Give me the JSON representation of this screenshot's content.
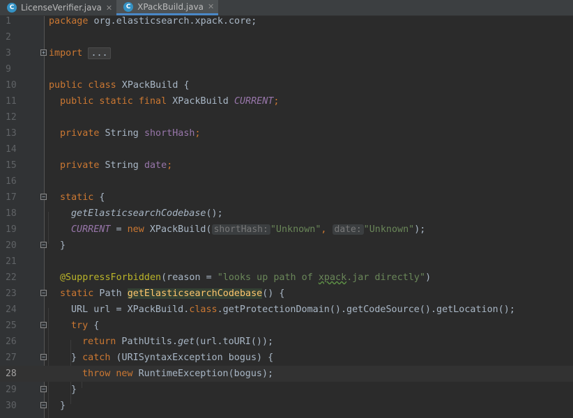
{
  "tabs": [
    {
      "label": "LicenseVerifier.java",
      "badge": "C",
      "active": false
    },
    {
      "label": "XPackBuild.java",
      "badge": "C",
      "active": true
    }
  ],
  "line_numbers": [
    "1",
    "2",
    "3",
    "9",
    "10",
    "11",
    "12",
    "13",
    "14",
    "15",
    "16",
    "17",
    "18",
    "19",
    "20",
    "21",
    "22",
    "23",
    "24",
    "25",
    "26",
    "27",
    "28",
    "29",
    "30"
  ],
  "current_line": "28",
  "code": {
    "l1": {
      "kw": "package",
      "rest": " org.elasticsearch.xpack.core;"
    },
    "l3": {
      "kw": "import",
      "pill": "..."
    },
    "l10": {
      "kw": "public class",
      "name": " XPackBuild",
      "rest": " {"
    },
    "l11": {
      "kw": "public static final",
      "type": " XPackBuild ",
      "field": "CURRENT",
      "end": ";"
    },
    "l13": {
      "kw": "private",
      "type": " String ",
      "field": "shortHash",
      "end": ";"
    },
    "l15": {
      "kw": "private",
      "type": " String ",
      "field": "date",
      "end": ";"
    },
    "l17": {
      "kw": "static",
      "rest": " {"
    },
    "l18": {
      "call": "getElasticsearchCodebase",
      "rest": "();"
    },
    "l19": {
      "field": "CURRENT",
      "eq": " = ",
      "kw": "new",
      "ctor": " XPackBuild(",
      "hint1": "shortHash:",
      "str1": "\"Unknown\"",
      "comma": ", ",
      "hint2": "date:",
      "str2": "\"Unknown\"",
      "end": ");"
    },
    "l20": {
      "rest": "}"
    },
    "l22": {
      "anno": "@SuppressForbidden",
      "open": "(reason = ",
      "str_a": "\"looks up path of ",
      "str_b": "xpack",
      "str_c": ".jar directly\"",
      "close": ")"
    },
    "l23": {
      "kw": "static",
      "type": " Path ",
      "method": "getElasticsearchCodebase",
      "rest": "() {"
    },
    "l24": {
      "a": "URL url = XPackBuild.",
      "kw": "class",
      "b": ".getProtectionDomain().getCodeSource().getLocation();"
    },
    "l25": {
      "kw": "try",
      "rest": " {"
    },
    "l26": {
      "kw": "return",
      "a": " PathUtils.",
      "call": "get",
      "b": "(url.toURI());"
    },
    "l27": {
      "a": "} ",
      "kw": "catch",
      "b": " (URISyntaxException bogus) {"
    },
    "l28": {
      "kw1": "throw",
      "sp": " ",
      "kw2": "new",
      "rest": " RuntimeException(bogus);"
    },
    "l29": {
      "rest": "}"
    },
    "l30": {
      "rest": "}"
    }
  },
  "colors": {
    "background": "#2b2b2b",
    "keyword": "#cc7832",
    "field": "#9876aa",
    "string": "#6a8759",
    "annotation": "#bbb529",
    "text": "#a9b7c6",
    "accent": "#4a88c7"
  },
  "icons": {
    "tab_badge": "java-class-icon",
    "tab_close": "close-icon",
    "fold": "fold-marker-icon"
  }
}
